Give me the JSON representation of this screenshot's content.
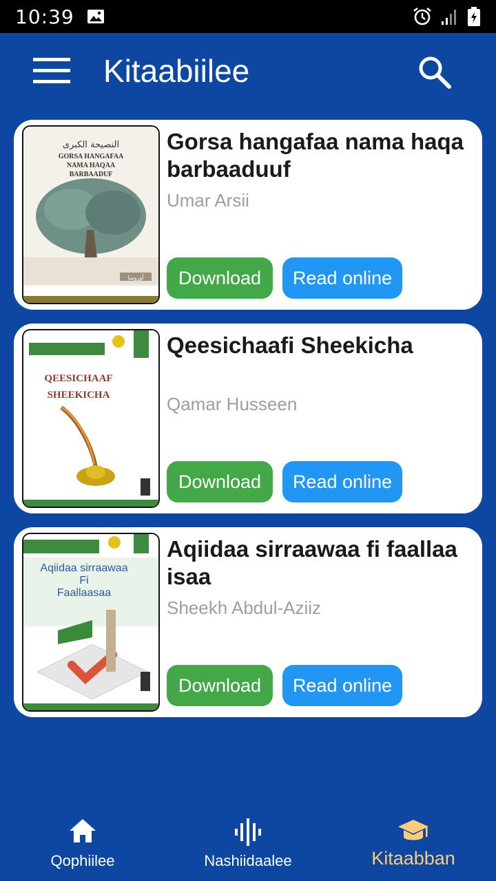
{
  "status_bar": {
    "time": "10:39",
    "icons": [
      "image-icon",
      "alarm-icon",
      "signal-icon",
      "battery-charging-icon"
    ]
  },
  "app_bar": {
    "title": "Kitaabiilee",
    "menu_icon": "hamburger-menu-icon",
    "search_icon": "search-icon"
  },
  "books": [
    {
      "title": "Gorsa hangafaa nama haqa barbaaduuf",
      "author": "Umar Arsii",
      "download_label": "Download",
      "read_label": "Read online",
      "cover": {
        "arabic_title": "النصيحة الكبرى",
        "lines": [
          "GORSA HANGAFAA",
          "NAMA HAQAA",
          "BARBAADUF"
        ],
        "bottom_label": "أوروميا"
      }
    },
    {
      "title": "Qeesichaafi Sheekicha",
      "author": "Qamar Husseen",
      "download_label": "Download",
      "read_label": "Read online",
      "cover": {
        "lines": [
          "QEESICHAAF",
          "SHEEKICHA"
        ]
      }
    },
    {
      "title": "Aqiidaa sirraawaa fi faallaa isaa",
      "author": "Sheekh Abdul-Aziiz",
      "download_label": "Download",
      "read_label": "Read online",
      "cover": {
        "lines": [
          "Aqiidaa sirraawaa",
          "Fi",
          "Faallaasaa"
        ]
      }
    }
  ],
  "bottom_nav": [
    {
      "label": "Qophiilee",
      "icon": "home-icon",
      "active": false
    },
    {
      "label": "Nashiidaalee",
      "icon": "audio-wave-icon",
      "active": false
    },
    {
      "label": "Kitaabban",
      "icon": "graduation-cap-icon",
      "active": true
    }
  ],
  "colors": {
    "primary": "#0d47a1",
    "download": "#43a847",
    "read": "#2196f3",
    "active_nav": "#ffca7a"
  }
}
